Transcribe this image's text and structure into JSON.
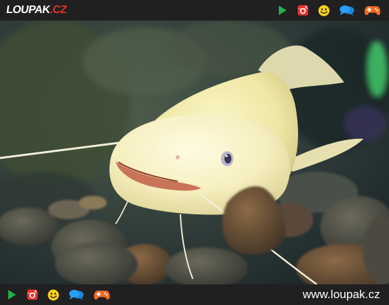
{
  "header": {
    "logo_main": "LOUPAK",
    "logo_tld": ".CZ"
  },
  "nav_icons": [
    "play-icon",
    "instagram-icon",
    "smiley-icon",
    "chat-icon",
    "gamepad-icon"
  ],
  "footer": {
    "url": "www.loupak.cz"
  },
  "colors": {
    "bar_background": "#202020",
    "logo_red": "#e8322c",
    "play_green": "#22b14c",
    "instagram_red": "#e8322c",
    "smiley_yellow": "#ffd21e",
    "chat_blue": "#2a9df4",
    "gamepad_orange": "#f26a22"
  }
}
